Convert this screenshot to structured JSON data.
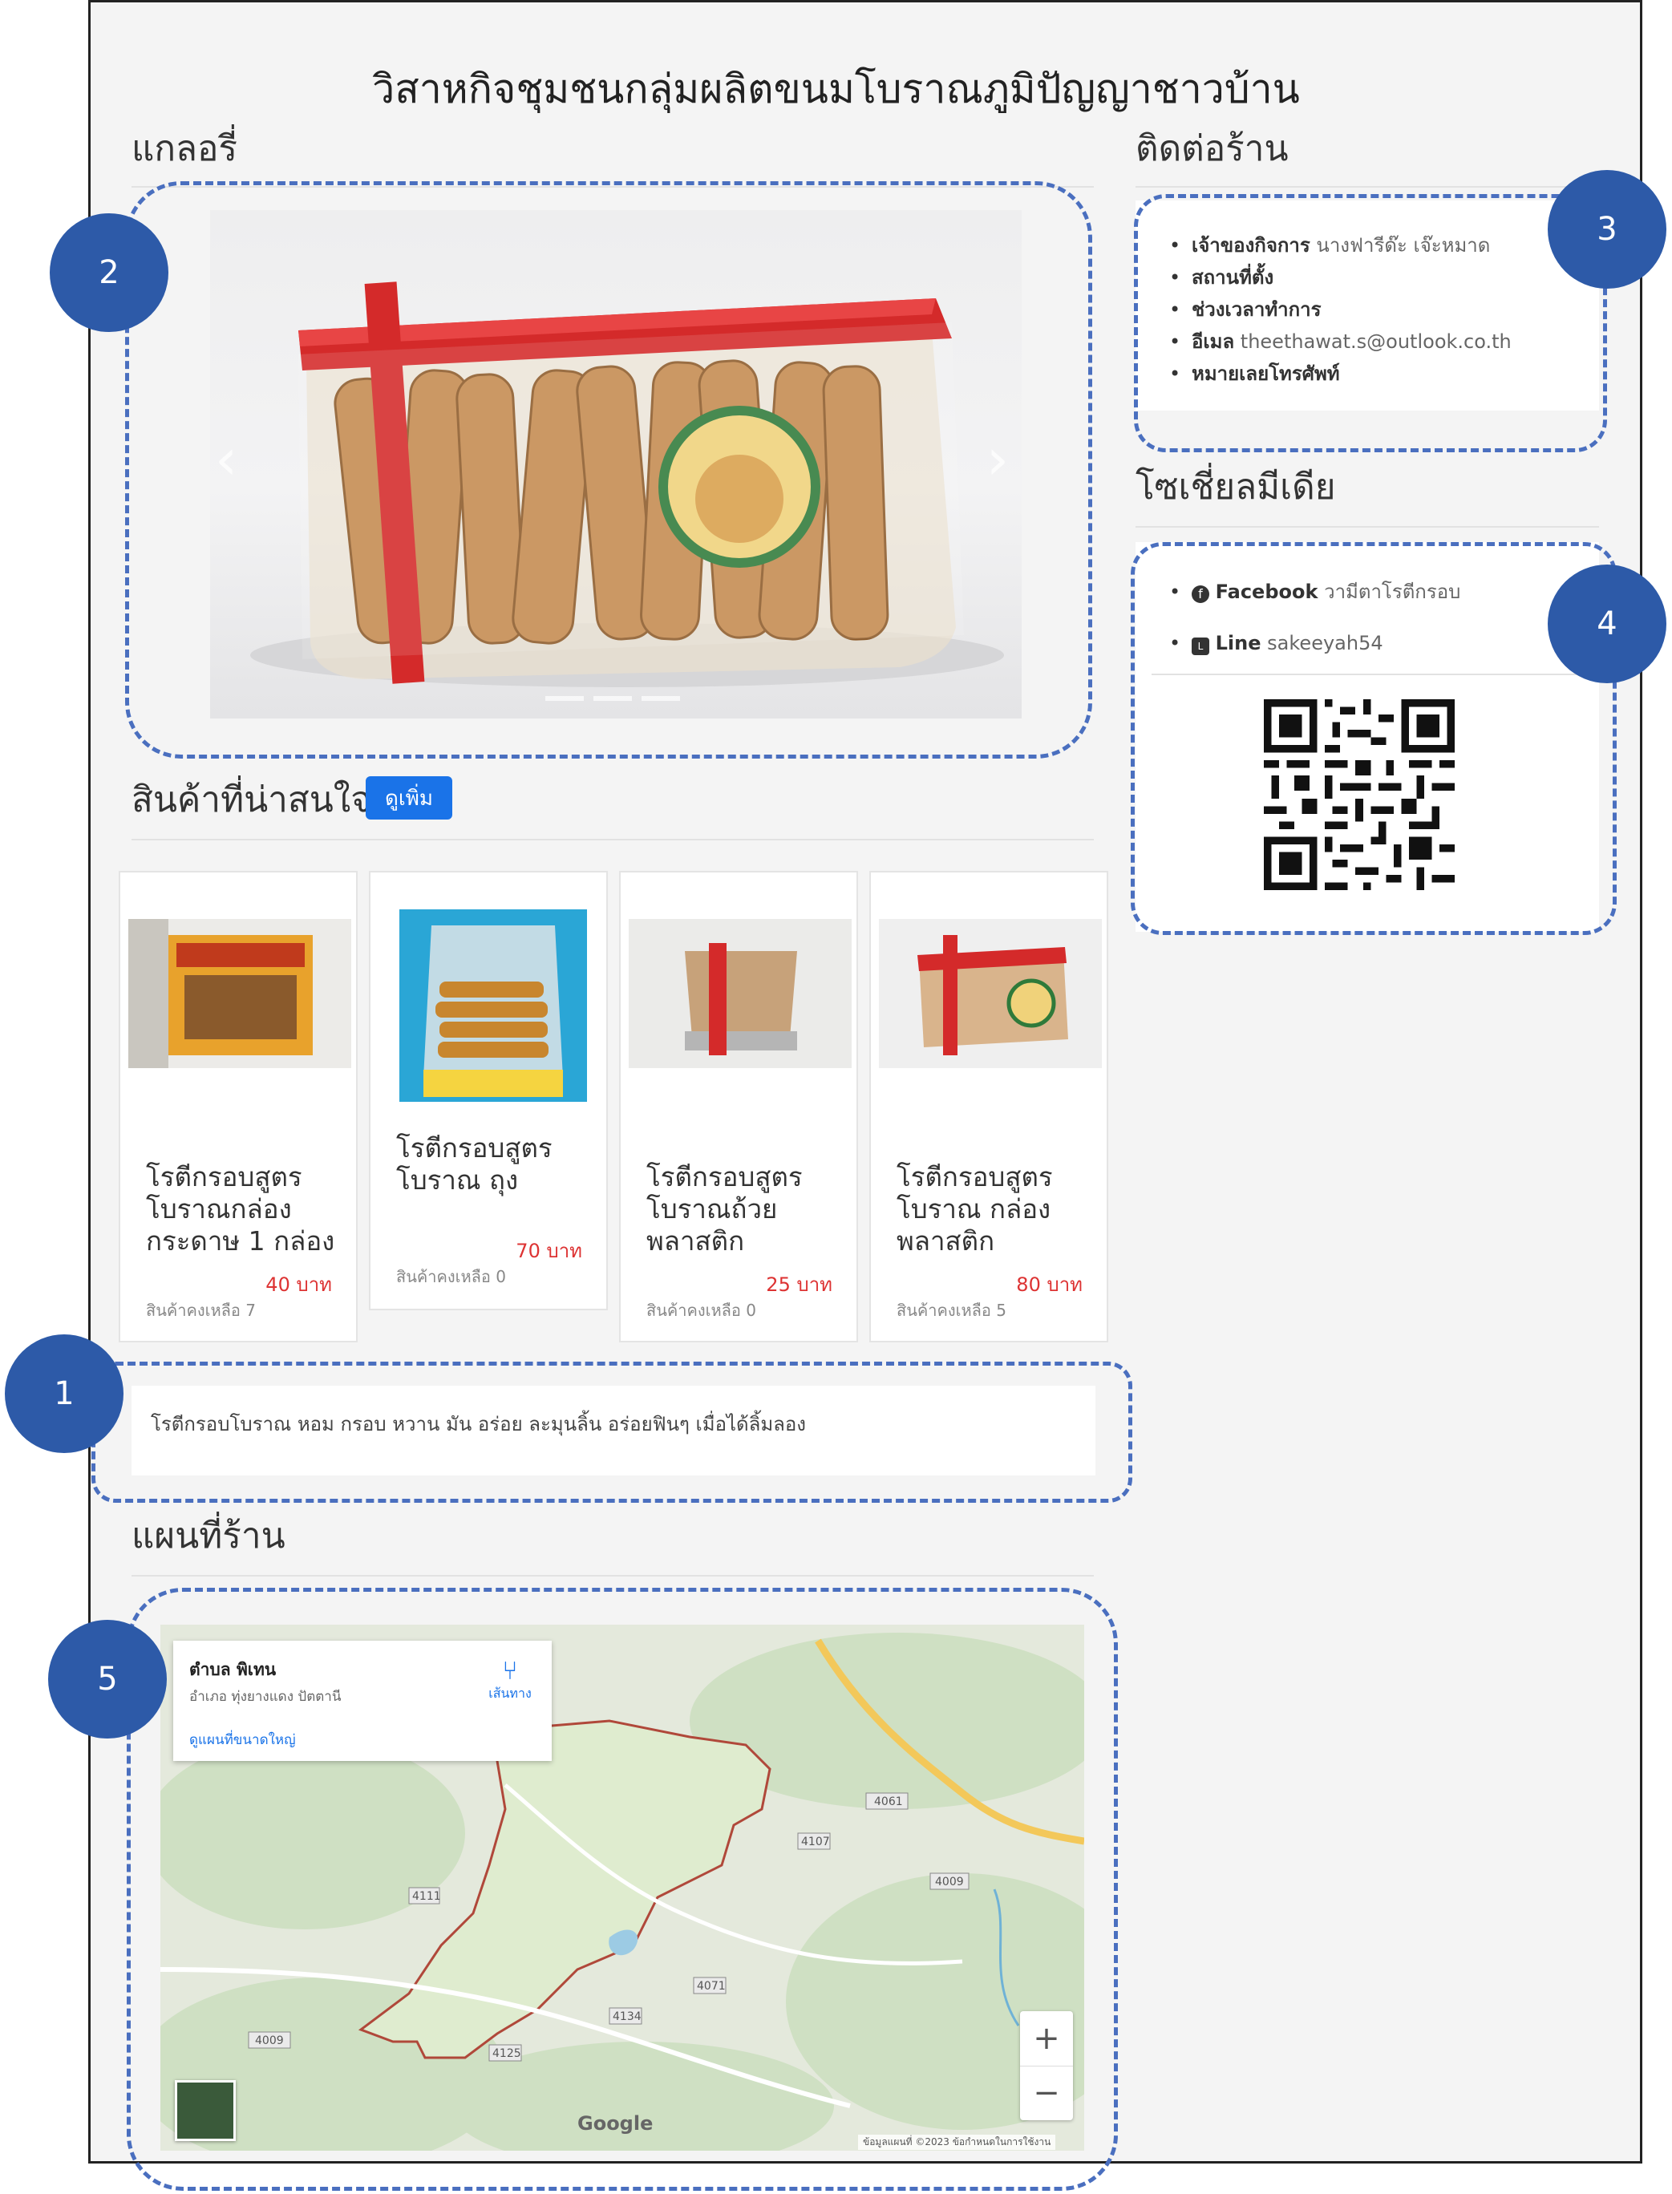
{
  "site": {
    "title": "วิสาหกิจชุมชนกลุ่มผลิตขนมโบราณภูมิปัญญาชาวบ้าน"
  },
  "gallery": {
    "heading": "แกลอรี่",
    "prev": "‹",
    "next": "›"
  },
  "products_section": {
    "heading": "สินค้าที่น่าสนใจ",
    "more_button": "ดูเพิ่ม"
  },
  "products": [
    {
      "title_lines": [
        "โรตีกรอบสูตร",
        "โบราณกล่อง",
        "กระดาษ 1 กล่อง"
      ],
      "price": "40 บาท",
      "stock": "สินค้าคงเหลือ 7"
    },
    {
      "title_lines": [
        "โรตีกรอบสูตร",
        "โบราณ ถุง"
      ],
      "price": "70 บาท",
      "stock": "สินค้าคงเหลือ 0"
    },
    {
      "title_lines": [
        "โรตีกรอบสูตร",
        "โบราณถ้วย",
        "พลาสติก"
      ],
      "price": "25 บาท",
      "stock": "สินค้าคงเหลือ 0"
    },
    {
      "title_lines": [
        "โรตีกรอบสูตร",
        "โบราณ กล่อง",
        "พลาสติก"
      ],
      "price": "80 บาท",
      "stock": "สินค้าคงเหลือ 5"
    }
  ],
  "description": "โรตีกรอบโบราณ หอม กรอบ หวาน มัน อร่อย ละมุนลิ้น อร่อยฟินๆ เมื่อได้ลิ้มลอง",
  "contact": {
    "heading": "ติดต่อร้าน",
    "items": [
      {
        "label": "เจ้าของกิจการ",
        "value": "นางฟารีด๊ะ เจ๊ะหมาด"
      },
      {
        "label": "สถานที่ตั้ง",
        "value": ""
      },
      {
        "label": "ช่วงเวลาทำการ",
        "value": ""
      },
      {
        "label": "อีเมล",
        "value": "theethawat.s@outlook.co.th"
      },
      {
        "label": "หมายเลยโทรศัพท์",
        "value": ""
      }
    ]
  },
  "social": {
    "heading": "โซเชี่ยลมีเดีย",
    "facebook_label": "Facebook",
    "facebook_value": "วามีตาโรตีกรอบ",
    "line_label": "Line",
    "line_value": "sakeeyah54",
    "facebook_icon": "facebook-icon",
    "line_icon": "line-icon"
  },
  "map": {
    "heading": "แผนที่ร้าน",
    "place_name": "ตำบล พิเทน",
    "place_address": "อำเภอ ทุ่งยางแดง ปัตตานี",
    "directions_label": "เส้นทาง",
    "larger_map_link": "ดูแผนที่ขนาดใหญ่",
    "zoom_in": "+",
    "zoom_out": "−",
    "google_logo": "Google",
    "footer_text": "ข้อมูลแผนที่ ©2023   ข้อกำหนดในการใช้งาน",
    "road_labels": [
      "4061",
      "4111",
      "4107",
      "4009",
      "4071",
      "4009",
      "4134",
      "4125"
    ]
  },
  "badges": [
    "1",
    "2",
    "3",
    "4",
    "5"
  ],
  "colors": {
    "accent": "#1a73e8",
    "price": "#dd3333",
    "badge": "#2d5aa8",
    "dashed": "#4a6fbf"
  }
}
